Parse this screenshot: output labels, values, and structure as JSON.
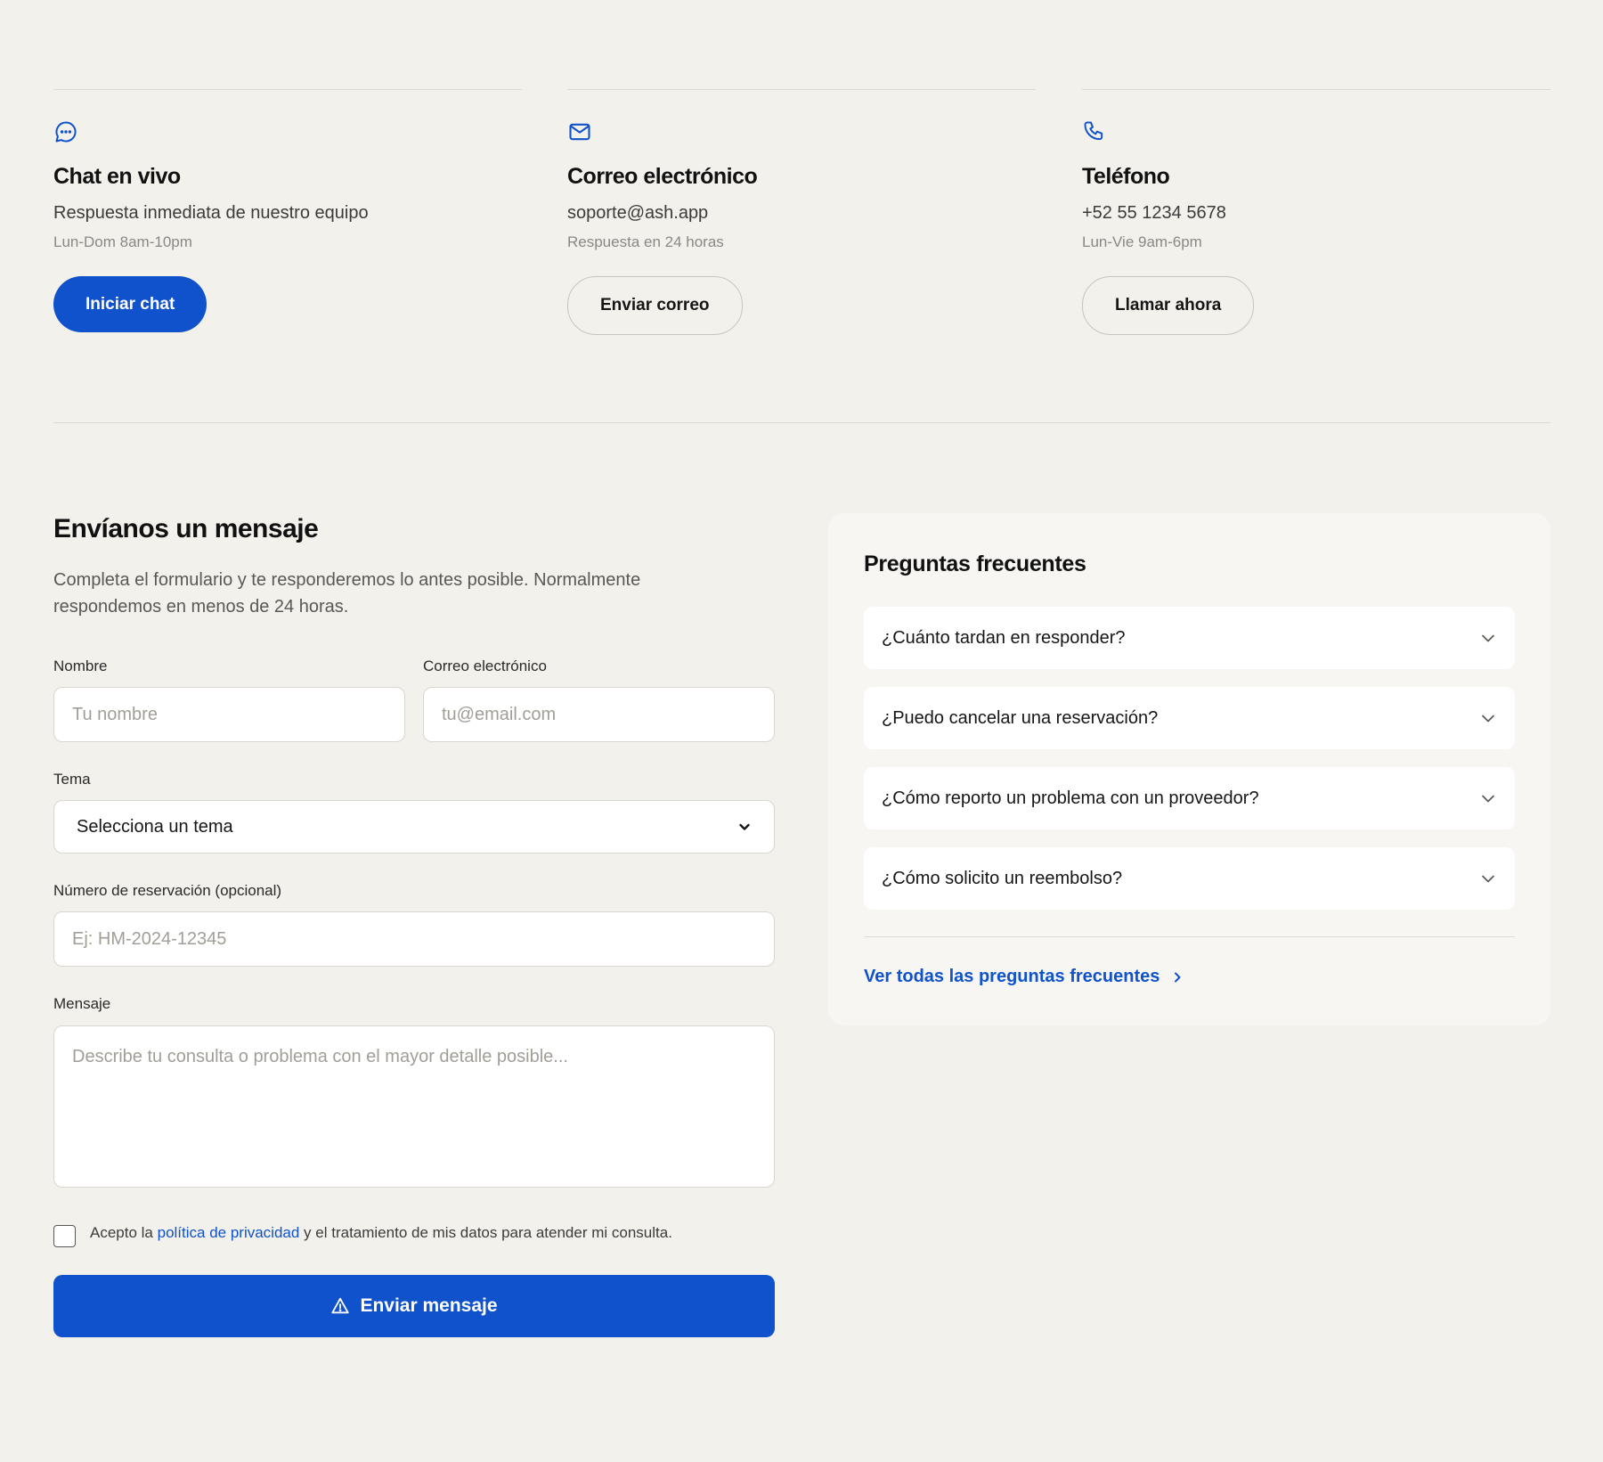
{
  "contact": {
    "chat": {
      "icon": "chat-bubble-icon",
      "title": "Chat en vivo",
      "description": "Respuesta inmediata de nuestro equipo",
      "hours": "Lun-Dom 8am-10pm",
      "button": "Iniciar chat"
    },
    "email": {
      "icon": "mail-icon",
      "title": "Correo electrónico",
      "description": "soporte@ash.app",
      "hours": "Respuesta en 24 horas",
      "button": "Enviar correo"
    },
    "phone": {
      "icon": "phone-icon",
      "title": "Teléfono",
      "description": "+52 55 1234 5678",
      "hours": "Lun-Vie 9am-6pm",
      "button": "Llamar ahora"
    }
  },
  "form": {
    "title": "Envíanos un mensaje",
    "intro": "Completa el formulario y te responderemos lo antes posible. Normalmente respondemos en menos de 24 horas.",
    "name_label": "Nombre",
    "name_placeholder": "Tu nombre",
    "name_value": "",
    "email_label": "Correo electrónico",
    "email_placeholder": "tu@email.com",
    "email_value": "",
    "topic_label": "Tema",
    "topic_selected": "Selecciona un tema",
    "reservation_label": "Número de reservación (opcional)",
    "reservation_placeholder": "Ej: HM-2024-12345",
    "reservation_value": "",
    "message_label": "Mensaje",
    "message_placeholder": "Describe tu consulta o problema con el mayor detalle posible...",
    "message_value": "",
    "consent_prefix": "Acepto la ",
    "consent_link": "política de privacidad",
    "consent_suffix": " y el tratamiento de mis datos para atender mi consulta.",
    "consent_checked": false,
    "submit_label": "Enviar mensaje",
    "submit_icon": "warning-triangle-icon"
  },
  "faq": {
    "title": "Preguntas frecuentes",
    "items": [
      {
        "question": "¿Cuánto tardan en responder?"
      },
      {
        "question": "¿Puedo cancelar una reservación?"
      },
      {
        "question": "¿Cómo reporto un problema con un proveedor?"
      },
      {
        "question": "¿Cómo solicito un reembolso?"
      }
    ],
    "view_all": "Ver todas las preguntas frecuentes"
  },
  "colors": {
    "background": "#f3f1ec",
    "accent": "#0f52cc",
    "panel": "#f7f6f3",
    "text": "#161616"
  }
}
